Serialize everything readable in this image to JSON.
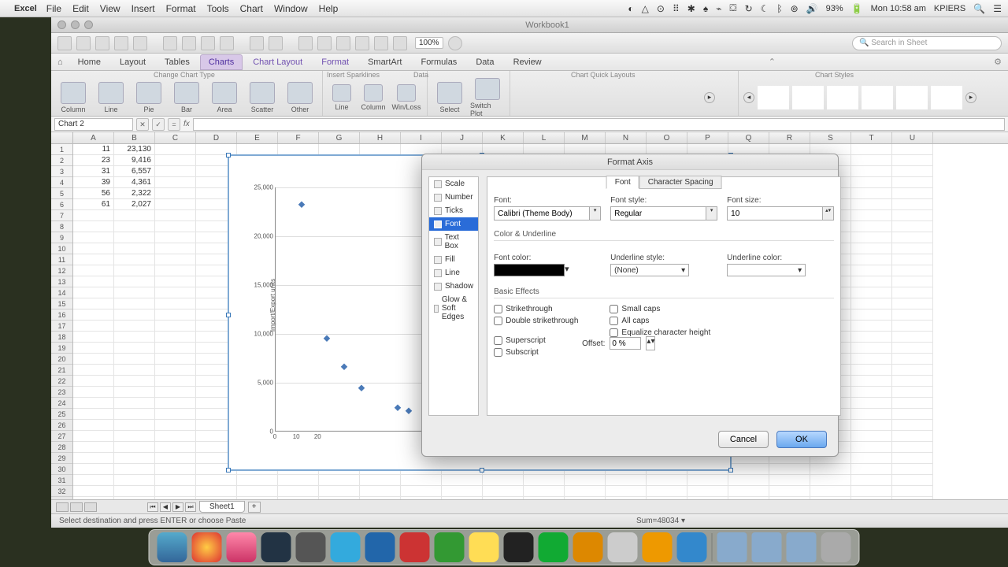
{
  "menubar": {
    "app": "Excel",
    "items": [
      "File",
      "Edit",
      "View",
      "Insert",
      "Format",
      "Tools",
      "Chart",
      "Window",
      "Help"
    ],
    "battery": "93%",
    "clock": "Mon 10:58 am",
    "user": "KPIERS"
  },
  "window": {
    "title": "Workbook1"
  },
  "toolbar": {
    "zoom": "100%",
    "search_placeholder": "Search in Sheet"
  },
  "ribbon_tabs": [
    "Home",
    "Layout",
    "Tables",
    "Charts",
    "Chart Layout",
    "Format",
    "SmartArt",
    "Formulas",
    "Data",
    "Review"
  ],
  "ribbon_active": "Charts",
  "ribbon_groups": {
    "change_type": {
      "label": "Change Chart Type",
      "buttons": [
        "Column",
        "Line",
        "Pie",
        "Bar",
        "Area",
        "Scatter",
        "Other"
      ]
    },
    "sparklines": {
      "label": "Insert Sparklines",
      "buttons": [
        "Line",
        "Column",
        "Win/Loss"
      ]
    },
    "data": {
      "label": "Data",
      "buttons": [
        "Select",
        "Switch Plot"
      ]
    },
    "quick": {
      "label": "Chart Quick Layouts"
    },
    "styles": {
      "label": "Chart Styles"
    }
  },
  "formula_bar": {
    "name": "Chart 2",
    "fx_label": "fx"
  },
  "columns": [
    "A",
    "B",
    "C",
    "D",
    "E",
    "F",
    "G",
    "H",
    "I",
    "J",
    "K",
    "L",
    "M",
    "N",
    "O",
    "P",
    "Q",
    "R",
    "S",
    "T",
    "U"
  ],
  "data_rows": [
    {
      "a": "11",
      "b": "23,130"
    },
    {
      "a": "23",
      "b": "9,416"
    },
    {
      "a": "31",
      "b": "6,557"
    },
    {
      "a": "39",
      "b": "4,361"
    },
    {
      "a": "56",
      "b": "2,322"
    },
    {
      "a": "61",
      "b": "2,027"
    }
  ],
  "chart_data": {
    "type": "scatter",
    "x": [
      11,
      23,
      31,
      39,
      56,
      61
    ],
    "y": [
      23130,
      9416,
      6557,
      4361,
      2322,
      2027
    ],
    "title": "",
    "xlabel": "",
    "ylabel": "Import/Export units",
    "xlim": [
      0,
      70
    ],
    "ylim": [
      0,
      25000
    ],
    "yticks": [
      "0",
      "5,000",
      "10,000",
      "15,000",
      "20,000",
      "25,000"
    ],
    "xticks": [
      "0",
      "10",
      "20"
    ]
  },
  "dialog": {
    "title": "Format Axis",
    "sidebar": [
      "Scale",
      "Number",
      "Ticks",
      "Font",
      "Text Box",
      "Fill",
      "Line",
      "Shadow",
      "Glow & Soft Edges"
    ],
    "sidebar_selected": "Font",
    "sub_tabs": [
      "Font",
      "Character Spacing"
    ],
    "sub_active": "Font",
    "font": {
      "label": "Font:",
      "value": "Calibri (Theme Body)",
      "style_label": "Font style:",
      "style_value": "Regular",
      "size_label": "Font size:",
      "size_value": "10"
    },
    "color_section": "Color & Underline",
    "font_color_label": "Font color:",
    "underline_style_label": "Underline style:",
    "underline_style_value": "(None)",
    "underline_color_label": "Underline color:",
    "effects_section": "Basic Effects",
    "effects_left": [
      "Strikethrough",
      "Double strikethrough",
      "Superscript",
      "Subscript"
    ],
    "effects_right": [
      "Small caps",
      "All caps",
      "Equalize character height"
    ],
    "offset_label": "Offset:",
    "offset_value": "0 %",
    "cancel": "Cancel",
    "ok": "OK"
  },
  "sheet_tabs": {
    "active": "Sheet1"
  },
  "status": {
    "message": "Select destination and press ENTER or choose Paste",
    "sum": "Sum=48034"
  }
}
